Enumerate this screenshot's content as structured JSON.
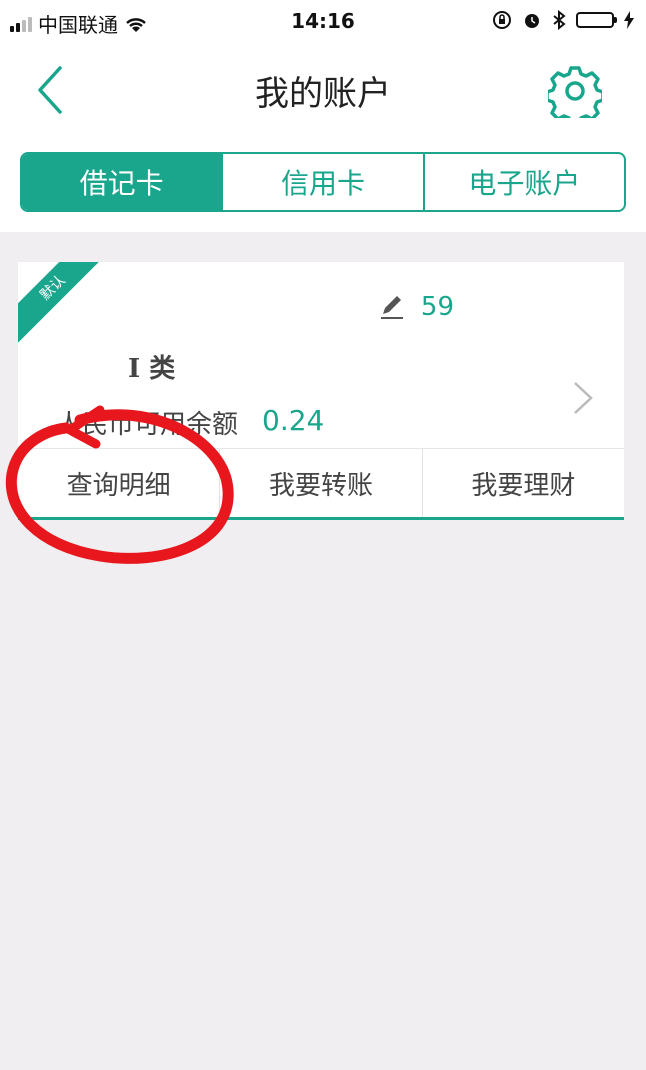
{
  "status_bar": {
    "carrier": "中国联通",
    "time": "14:16"
  },
  "nav": {
    "title": "我的账户",
    "back_icon": "chevron-left-icon",
    "settings_icon": "gear-icon"
  },
  "tabs": [
    {
      "label": "借记卡",
      "active": true
    },
    {
      "label": "信用卡",
      "active": false
    },
    {
      "label": "电子账户",
      "active": false
    }
  ],
  "card": {
    "ribbon": "默认",
    "account_no": "59",
    "account_type": "I 类",
    "balance_label": "人民币可用余额",
    "balance_value": "0.24",
    "actions": [
      {
        "label": "查询明细"
      },
      {
        "label": "我要转账"
      },
      {
        "label": "我要理财"
      }
    ]
  },
  "colors": {
    "accent": "#1aa68c",
    "annotation": "#e8161d"
  }
}
